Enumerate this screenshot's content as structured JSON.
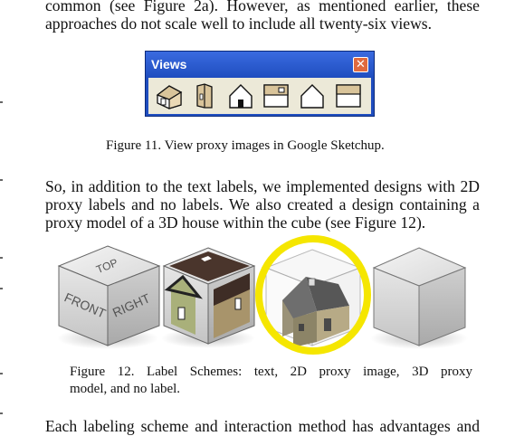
{
  "paragraph_top": [
    "common (see Figure 2a). However, as mentioned earlier, these",
    "approaches do not scale well to include all twenty-six views."
  ],
  "views_window": {
    "title": "Views",
    "close_glyph": "✕",
    "buttons": [
      "iso-house-icon",
      "left-view-icon",
      "front-view-icon",
      "top-view-icon",
      "right-view-icon",
      "back-view-icon"
    ]
  },
  "figure11_caption": "Figure 11. View proxy images in Google Sketchup.",
  "paragraph_middle": [
    "So, in addition to the text labels, we implemented designs with 2D",
    "proxy labels and no labels. We also created a design containing a",
    "proxy model of a 3D house within the cube (see Figure 12)."
  ],
  "cube_labels": {
    "top": "TOP",
    "front": "FRONT",
    "right": "RIGHT"
  },
  "highlight_color": "#f5e600",
  "figure12_caption": [
    "Figure 12. Label Schemes: text, 2D proxy image, 3D proxy",
    "model, and no label."
  ],
  "paragraph_bottom": [
    "Each labeling scheme and interaction method has advantages and"
  ]
}
